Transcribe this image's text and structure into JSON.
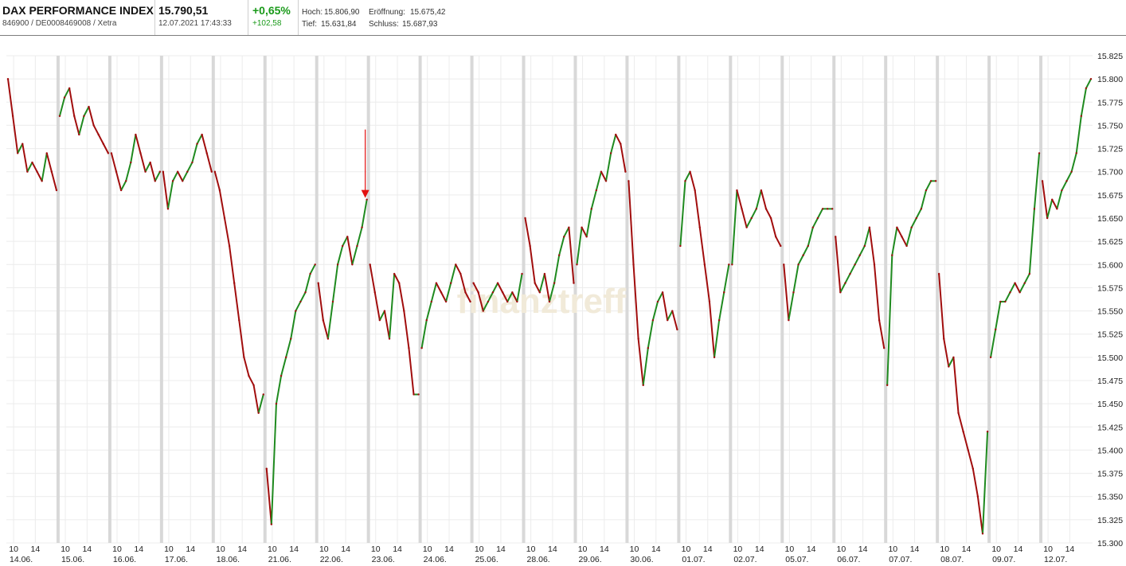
{
  "header": {
    "name": "DAX PERFORMANCE INDEX",
    "sub": "846900 / DE0008469008 / Xetra",
    "price": "15.790,51",
    "time": "12.07.2021 17:43:33",
    "change_pct": "+0,65%",
    "change_abs": "+102,58",
    "high_label": "Hoch:",
    "high": "15.806,90",
    "open_label": "Eröffnung:",
    "open": "15.675,42",
    "low_label": "Tief:",
    "low": "15.631,84",
    "close_label": "Schluss:",
    "close": "15.687,93"
  },
  "watermark": "finanztreff",
  "colors": {
    "down": "#a10d0d",
    "up": "#1f8a1f",
    "marker": "#e31010",
    "grid": "#ececec",
    "day_sep": "#d8d8d8",
    "positive": "#1a9a1a"
  },
  "chart_data": {
    "type": "line",
    "title": "",
    "xlabel": "",
    "ylabel": "",
    "ylim": [
      15300,
      15825
    ],
    "yticks": [
      15300,
      15325,
      15350,
      15375,
      15400,
      15425,
      15450,
      15475,
      15500,
      15525,
      15550,
      15575,
      15600,
      15625,
      15650,
      15675,
      15700,
      15725,
      15750,
      15775,
      15800,
      15825
    ],
    "ytick_labels": [
      "15.300",
      "15.325",
      "15.350",
      "15.375",
      "15.400",
      "15.425",
      "15.450",
      "15.475",
      "15.500",
      "15.525",
      "15.550",
      "15.575",
      "15.600",
      "15.625",
      "15.650",
      "15.675",
      "15.700",
      "15.725",
      "15.750",
      "15.775",
      "15.800",
      "15.825"
    ],
    "grid": true,
    "hour_labels": [
      "10",
      "14"
    ],
    "days": [
      {
        "label": "14.06.",
        "values": [
          15800,
          15760,
          15720,
          15730,
          15700,
          15710,
          15700,
          15690,
          15720,
          15700,
          15680
        ]
      },
      {
        "label": "15.06.",
        "values": [
          15760,
          15780,
          15790,
          15760,
          15740,
          15760,
          15770,
          15750,
          15740,
          15730,
          15720
        ]
      },
      {
        "label": "16.06.",
        "values": [
          15720,
          15700,
          15680,
          15690,
          15710,
          15740,
          15720,
          15700,
          15710,
          15690,
          15700
        ]
      },
      {
        "label": "17.06.",
        "values": [
          15700,
          15660,
          15690,
          15700,
          15690,
          15700,
          15710,
          15730,
          15740,
          15720,
          15700
        ]
      },
      {
        "label": "18.06.",
        "values": [
          15700,
          15680,
          15650,
          15620,
          15580,
          15540,
          15500,
          15480,
          15470,
          15440,
          15460
        ]
      },
      {
        "label": "21.06.",
        "values": [
          15380,
          15320,
          15450,
          15480,
          15500,
          15520,
          15550,
          15560,
          15570,
          15590,
          15600
        ]
      },
      {
        "label": "22.06.",
        "values": [
          15580,
          15540,
          15520,
          15560,
          15600,
          15620,
          15630,
          15600,
          15620,
          15640,
          15670
        ]
      },
      {
        "label": "23.06.",
        "values": [
          15600,
          15570,
          15540,
          15550,
          15520,
          15590,
          15580,
          15550,
          15510,
          15460,
          15460
        ]
      },
      {
        "label": "24.06.",
        "values": [
          15510,
          15540,
          15560,
          15580,
          15570,
          15560,
          15580,
          15600,
          15590,
          15570,
          15560
        ]
      },
      {
        "label": "25.06.",
        "values": [
          15580,
          15570,
          15550,
          15560,
          15570,
          15580,
          15570,
          15560,
          15570,
          15560,
          15590
        ]
      },
      {
        "label": "28.06.",
        "values": [
          15650,
          15620,
          15580,
          15570,
          15590,
          15560,
          15580,
          15610,
          15630,
          15640,
          15580
        ]
      },
      {
        "label": "29.06.",
        "values": [
          15600,
          15640,
          15630,
          15660,
          15680,
          15700,
          15690,
          15720,
          15740,
          15730,
          15700
        ]
      },
      {
        "label": "30.06.",
        "values": [
          15690,
          15600,
          15520,
          15470,
          15510,
          15540,
          15560,
          15570,
          15540,
          15550,
          15530
        ]
      },
      {
        "label": "01.07.",
        "values": [
          15620,
          15690,
          15700,
          15680,
          15640,
          15600,
          15560,
          15500,
          15540,
          15570,
          15600
        ]
      },
      {
        "label": "02.07.",
        "values": [
          15600,
          15680,
          15660,
          15640,
          15650,
          15660,
          15680,
          15660,
          15650,
          15630,
          15620
        ]
      },
      {
        "label": "05.07.",
        "values": [
          15600,
          15540,
          15570,
          15600,
          15610,
          15620,
          15640,
          15650,
          15660,
          15660,
          15660
        ]
      },
      {
        "label": "06.07.",
        "values": [
          15630,
          15570,
          15580,
          15590,
          15600,
          15610,
          15620,
          15640,
          15600,
          15540,
          15510
        ]
      },
      {
        "label": "07.07.",
        "values": [
          15470,
          15610,
          15640,
          15630,
          15620,
          15640,
          15650,
          15660,
          15680,
          15690,
          15690
        ]
      },
      {
        "label": "08.07.",
        "values": [
          15590,
          15520,
          15490,
          15500,
          15440,
          15420,
          15400,
          15380,
          15350,
          15310,
          15420
        ]
      },
      {
        "label": "09.07.",
        "values": [
          15500,
          15530,
          15560,
          15560,
          15570,
          15580,
          15570,
          15580,
          15590,
          15660,
          15720
        ]
      },
      {
        "label": "12.07.",
        "values": [
          15690,
          15650,
          15670,
          15660,
          15680,
          15690,
          15700,
          15720,
          15760,
          15790,
          15800
        ]
      }
    ],
    "annotation": {
      "type": "arrow",
      "day": "22.06.",
      "value": 15670
    }
  }
}
